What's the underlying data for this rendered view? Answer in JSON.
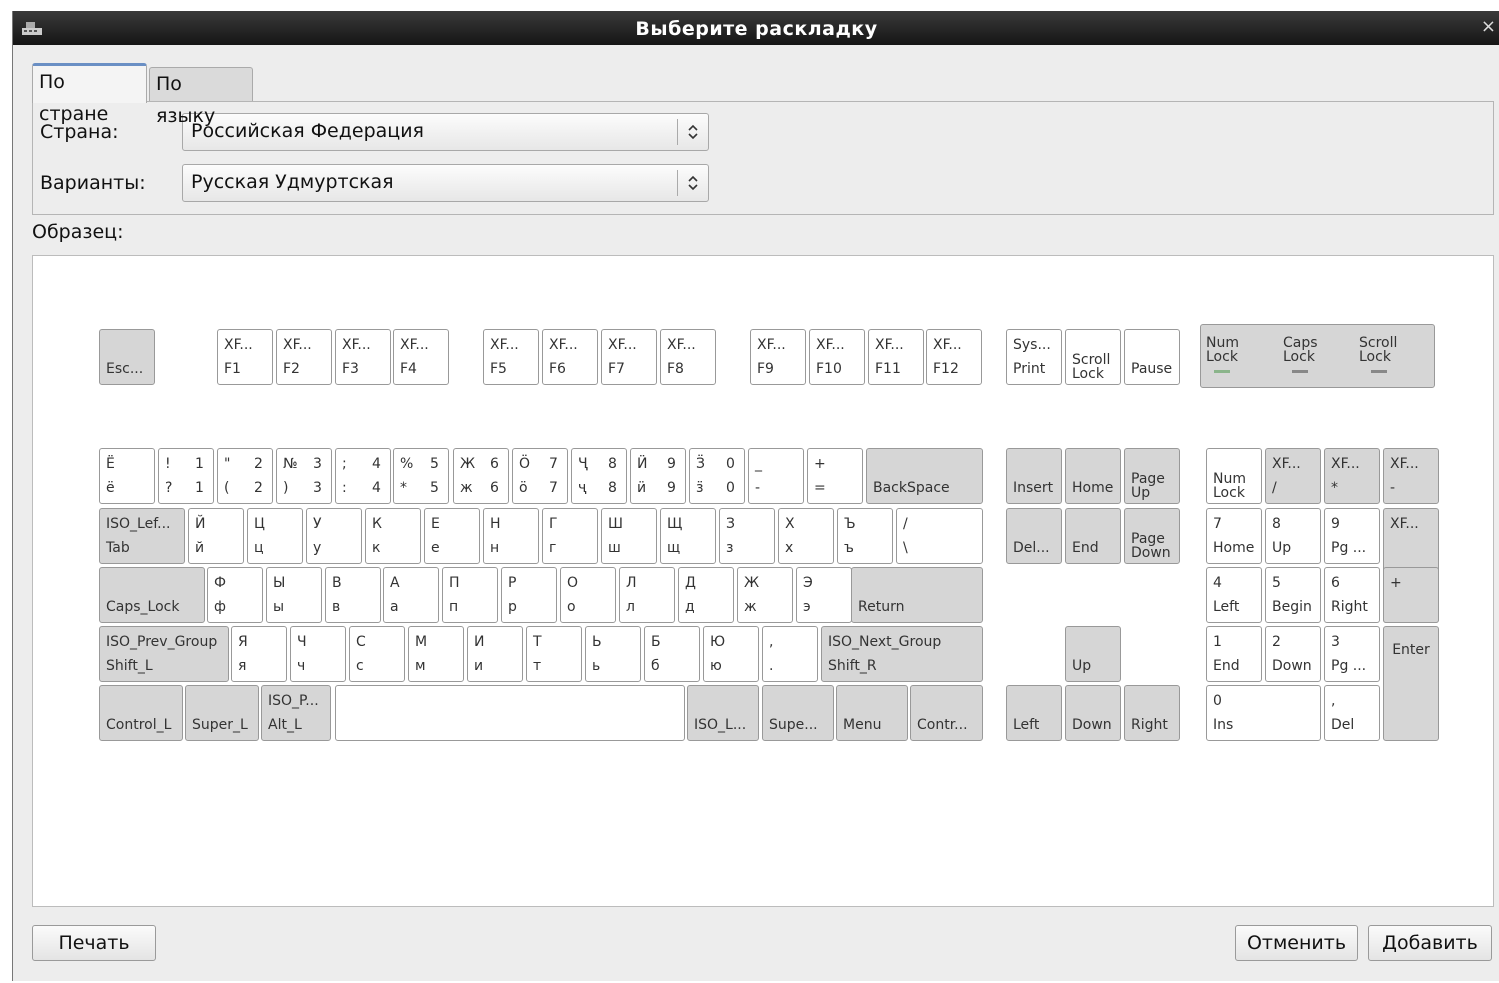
{
  "window": {
    "title": "Выберите раскладку",
    "close_glyph": "×"
  },
  "tabs": [
    {
      "label": "По стране"
    },
    {
      "label": "По языку"
    }
  ],
  "form": {
    "country_label": "Страна:",
    "country_value": "Российская Федерация",
    "variant_label": "Варианты:",
    "variant_value": "Русская Удмуртская"
  },
  "sample_label": "Образец:",
  "keyboard": {
    "leds": [
      "Num\nLock",
      "Caps\nLock",
      "Scroll\nLock"
    ],
    "keys": [
      {
        "t": "",
        "b": "Esc...",
        "style": "fn"
      },
      {
        "t": "XF...",
        "b": "F1",
        "style": "ch"
      },
      {
        "t": "XF...",
        "b": "F2",
        "style": "ch"
      },
      {
        "t": "XF...",
        "b": "F3",
        "style": "ch"
      },
      {
        "t": "XF...",
        "b": "F4",
        "style": "ch"
      },
      {
        "t": "XF...",
        "b": "F5",
        "style": "ch"
      },
      {
        "t": "XF...",
        "b": "F6",
        "style": "ch"
      },
      {
        "t": "XF...",
        "b": "F7",
        "style": "ch"
      },
      {
        "t": "XF...",
        "b": "F8",
        "style": "ch"
      },
      {
        "t": "XF...",
        "b": "F9",
        "style": "ch"
      },
      {
        "t": "XF...",
        "b": "F10",
        "style": "ch"
      },
      {
        "t": "XF...",
        "b": "F11",
        "style": "ch"
      },
      {
        "t": "XF...",
        "b": "F12",
        "style": "ch"
      },
      {
        "t": "Sys...",
        "b": "Print",
        "style": "ch"
      },
      {
        "t": "",
        "b": "Scroll\nLock",
        "style": "ch"
      },
      {
        "t": "",
        "b": "Pause",
        "style": "ch"
      },
      {
        "t": "Ё",
        "b": "ё",
        "style": "ch"
      },
      {
        "t": "!",
        "b": "?",
        "tr": "1",
        "br": "1",
        "style": "ch"
      },
      {
        "t": "\"",
        "b": "(",
        "tr": "2",
        "br": "2",
        "style": "ch"
      },
      {
        "t": "№",
        "b": ")",
        "tr": "3",
        "br": "3",
        "style": "ch"
      },
      {
        "t": ";",
        "b": ":",
        "tr": "4",
        "br": "4",
        "style": "ch"
      },
      {
        "t": "%",
        "b": "*",
        "tr": "5",
        "br": "5",
        "style": "ch"
      },
      {
        "t": "Ж",
        "b": "ж",
        "tr": "6",
        "br": "6",
        "style": "ch"
      },
      {
        "t": "Ö",
        "b": "ö",
        "tr": "7",
        "br": "7",
        "style": "ch"
      },
      {
        "t": "Ҷ",
        "b": "ҷ",
        "tr": "8",
        "br": "8",
        "style": "ch"
      },
      {
        "t": "Ӥ",
        "b": "ӥ",
        "tr": "9",
        "br": "9",
        "style": "ch"
      },
      {
        "t": "Ӟ",
        "b": "ӟ",
        "tr": "0",
        "br": "0",
        "style": "ch"
      },
      {
        "t": "_",
        "b": "-",
        "style": "ch"
      },
      {
        "t": "+",
        "b": "=",
        "style": "ch"
      },
      {
        "t": "",
        "b": "BackSpace",
        "style": "fn"
      },
      {
        "t": "",
        "b": "Insert",
        "style": "fn"
      },
      {
        "t": "",
        "b": "Home",
        "style": "fn"
      },
      {
        "t": "",
        "b": "Page\nUp",
        "style": "fn"
      },
      {
        "t": "",
        "b": "Num\nLock",
        "style": "ch"
      },
      {
        "t": "XF...",
        "b": "/",
        "style": "fn"
      },
      {
        "t": "XF...",
        "b": "*",
        "style": "fn"
      },
      {
        "t": "XF...",
        "b": "-",
        "style": "fn"
      },
      {
        "t": "ISO_Lef...",
        "b": "Tab",
        "style": "fn"
      },
      {
        "t": "Й",
        "b": "й",
        "style": "ch"
      },
      {
        "t": "Ц",
        "b": "ц",
        "style": "ch"
      },
      {
        "t": "У",
        "b": "у",
        "style": "ch"
      },
      {
        "t": "К",
        "b": "к",
        "style": "ch"
      },
      {
        "t": "Е",
        "b": "е",
        "style": "ch"
      },
      {
        "t": "Н",
        "b": "н",
        "style": "ch"
      },
      {
        "t": "Г",
        "b": "г",
        "style": "ch"
      },
      {
        "t": "Ш",
        "b": "ш",
        "style": "ch"
      },
      {
        "t": "Щ",
        "b": "щ",
        "style": "ch"
      },
      {
        "t": "З",
        "b": "з",
        "style": "ch"
      },
      {
        "t": "Х",
        "b": "х",
        "style": "ch"
      },
      {
        "t": "Ъ",
        "b": "ъ",
        "style": "ch"
      },
      {
        "t": "/",
        "b": "\\",
        "style": "ch"
      },
      {
        "t": "",
        "b": "Del...",
        "style": "fn"
      },
      {
        "t": "",
        "b": "End",
        "style": "fn"
      },
      {
        "t": "",
        "b": "Page\nDown",
        "style": "fn"
      },
      {
        "t": "7",
        "b": "Home",
        "style": "ch"
      },
      {
        "t": "8",
        "b": "Up",
        "style": "ch"
      },
      {
        "t": "9",
        "b": "Pg ...",
        "style": "ch"
      },
      {
        "t": "XF...",
        "b": "",
        "style": "fn"
      },
      {
        "t": "",
        "b": "Caps_Lock",
        "style": "fn"
      },
      {
        "t": "Ф",
        "b": "ф",
        "style": "ch"
      },
      {
        "t": "Ы",
        "b": "ы",
        "style": "ch"
      },
      {
        "t": "В",
        "b": "в",
        "style": "ch"
      },
      {
        "t": "А",
        "b": "а",
        "style": "ch"
      },
      {
        "t": "П",
        "b": "п",
        "style": "ch"
      },
      {
        "t": "Р",
        "b": "р",
        "style": "ch"
      },
      {
        "t": "О",
        "b": "о",
        "style": "ch"
      },
      {
        "t": "Л",
        "b": "л",
        "style": "ch"
      },
      {
        "t": "Д",
        "b": "д",
        "style": "ch"
      },
      {
        "t": "Ж",
        "b": "ж",
        "style": "ch"
      },
      {
        "t": "Э",
        "b": "э",
        "style": "ch"
      },
      {
        "t": "",
        "b": "Return",
        "style": "fn"
      },
      {
        "t": "4",
        "b": "Left",
        "style": "ch"
      },
      {
        "t": "5",
        "b": "Begin",
        "style": "ch"
      },
      {
        "t": "6",
        "b": "Right",
        "style": "ch"
      },
      {
        "t": "+",
        "b": "",
        "style": "fn"
      },
      {
        "t": "ISO_Prev_Group",
        "b": "Shift_L",
        "style": "fn"
      },
      {
        "t": "Я",
        "b": "я",
        "style": "ch"
      },
      {
        "t": "Ч",
        "b": "ч",
        "style": "ch"
      },
      {
        "t": "С",
        "b": "с",
        "style": "ch"
      },
      {
        "t": "М",
        "b": "м",
        "style": "ch"
      },
      {
        "t": "И",
        "b": "и",
        "style": "ch"
      },
      {
        "t": "Т",
        "b": "т",
        "style": "ch"
      },
      {
        "t": "Ь",
        "b": "ь",
        "style": "ch"
      },
      {
        "t": "Б",
        "b": "б",
        "style": "ch"
      },
      {
        "t": "Ю",
        "b": "ю",
        "style": "ch"
      },
      {
        "t": ",",
        "b": ".",
        "style": "ch"
      },
      {
        "t": "ISO_Next_Group",
        "b": "Shift_R",
        "style": "fn"
      },
      {
        "t": "",
        "b": "Up",
        "style": "fn"
      },
      {
        "t": "1",
        "b": "End",
        "style": "ch"
      },
      {
        "t": "2",
        "b": "Down",
        "style": "ch"
      },
      {
        "t": "3",
        "b": "Pg ...",
        "style": "ch"
      },
      {
        "t": "",
        "b": "",
        "c": "Enter",
        "style": "fn"
      },
      {
        "t": "",
        "b": "Control_L",
        "style": "fn"
      },
      {
        "t": "",
        "b": "Super_L",
        "style": "fn"
      },
      {
        "t": "ISO_P...",
        "b": "Alt_L",
        "style": "fn"
      },
      {
        "t": "",
        "b": "",
        "style": "ch"
      },
      {
        "t": "",
        "b": "ISO_L...",
        "style": "fn"
      },
      {
        "t": "",
        "b": "Supe...",
        "style": "fn"
      },
      {
        "t": "",
        "b": "Menu",
        "style": "fn"
      },
      {
        "t": "",
        "b": "Contr...",
        "style": "fn"
      },
      {
        "t": "",
        "b": "Left",
        "style": "fn"
      },
      {
        "t": "",
        "b": "Down",
        "style": "fn"
      },
      {
        "t": "",
        "b": "Right",
        "style": "fn"
      },
      {
        "t": "0",
        "b": "Ins",
        "style": "ch"
      },
      {
        "t": ",",
        "b": "Del",
        "style": "ch"
      }
    ]
  },
  "buttons": {
    "print": "Печать",
    "cancel": "Отменить",
    "add": "Добавить"
  }
}
